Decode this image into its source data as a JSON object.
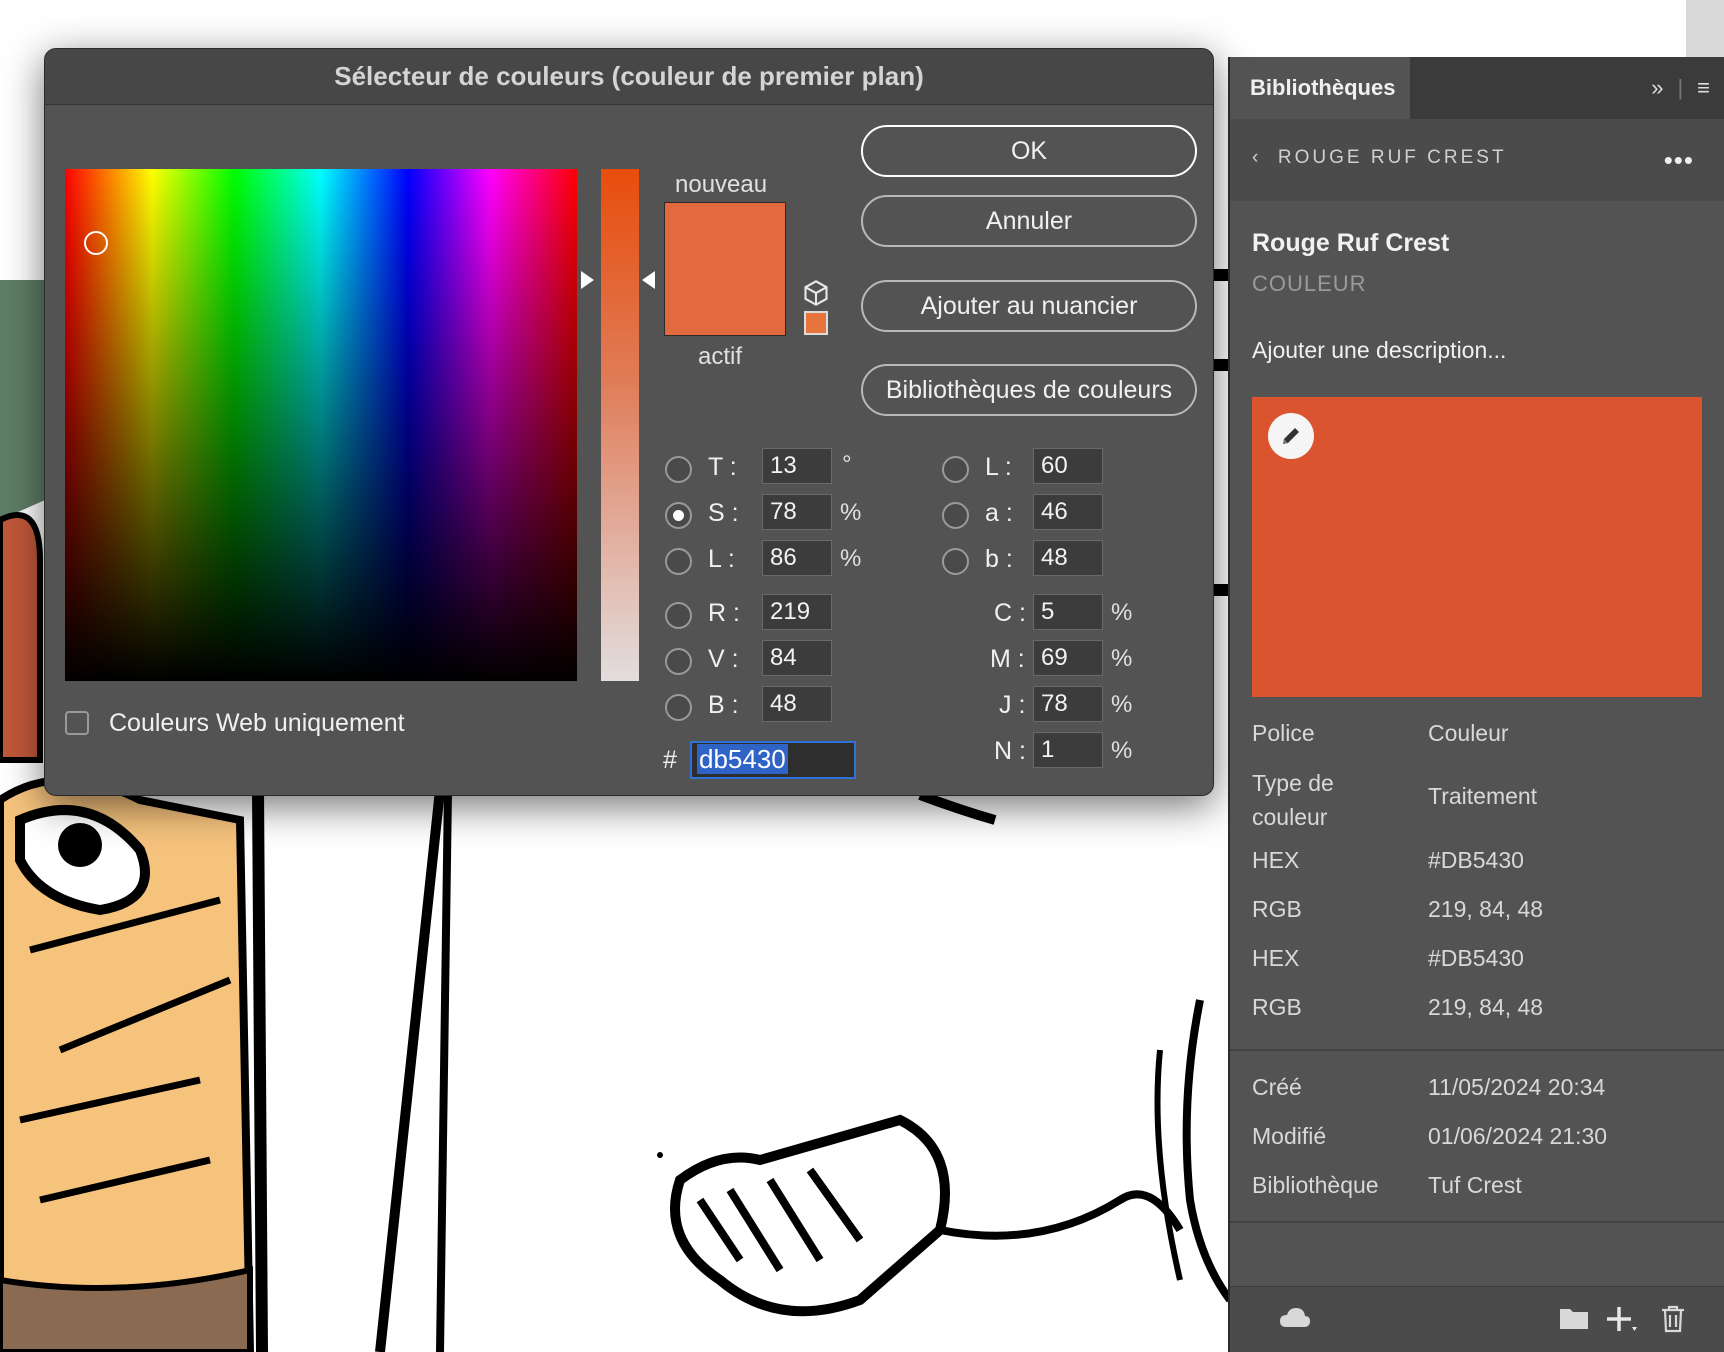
{
  "picker": {
    "title": "Sélecteur de couleurs (couleur de premier plan)",
    "new_label": "nouveau",
    "current_label": "actif",
    "buttons": {
      "ok": "OK",
      "cancel": "Annuler",
      "add_swatch": "Ajouter au nuancier",
      "color_libraries": "Bibliothèques de couleurs"
    },
    "fields": {
      "hsb": [
        {
          "label": "T :",
          "value": "13",
          "unit": "°",
          "selected": false
        },
        {
          "label": "S :",
          "value": "78",
          "unit": "%",
          "selected": true
        },
        {
          "label": "L :",
          "value": "86",
          "unit": "%",
          "selected": false
        }
      ],
      "rgb": [
        {
          "label": "R :",
          "value": "219"
        },
        {
          "label": "V :",
          "value": "84"
        },
        {
          "label": "B :",
          "value": "48"
        }
      ],
      "lab": [
        {
          "label": "L :",
          "value": "60"
        },
        {
          "label": "a :",
          "value": "46"
        },
        {
          "label": "b :",
          "value": "48"
        }
      ],
      "cmyk": [
        {
          "label": "C :",
          "value": "5",
          "unit": "%"
        },
        {
          "label": "M :",
          "value": "69",
          "unit": "%"
        },
        {
          "label": "J :",
          "value": "78",
          "unit": "%"
        },
        {
          "label": "N :",
          "value": "1",
          "unit": "%"
        }
      ],
      "hex_prefix": "#",
      "hex": "db5430"
    },
    "web_only_label": "Couleurs Web uniquement",
    "new_color": "#e3693e",
    "current_color": "#e3693e"
  },
  "panel": {
    "tab": "Bibliothèques",
    "back_label": "ROUGE RUF CREST",
    "asset_name": "Rouge Ruf Crest",
    "asset_type": "COULEUR",
    "description_placeholder": "Ajouter une description...",
    "swatch_color": "#DB5430",
    "props": [
      {
        "key": "Police",
        "value": "Couleur"
      },
      {
        "key": "Type de couleur",
        "value": "Traitement"
      },
      {
        "key": "HEX",
        "value": "#DB5430"
      },
      {
        "key": "RGB",
        "value": "219, 84, 48"
      },
      {
        "key": "HEX",
        "value": "#DB5430"
      },
      {
        "key": "RGB",
        "value": "219, 84, 48"
      }
    ],
    "meta": [
      {
        "key": "Créé",
        "value": "11/05/2024 20:34"
      },
      {
        "key": "Modifié",
        "value": "01/06/2024 21:30"
      },
      {
        "key": "Bibliothèque",
        "value": "Tuf Crest"
      }
    ]
  }
}
